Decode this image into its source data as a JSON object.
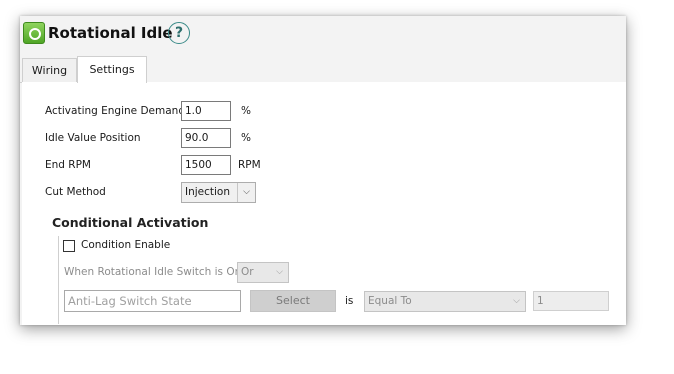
{
  "window": {
    "title": "Rotational Idle",
    "help": "?"
  },
  "tabs": [
    {
      "label": "Wiring",
      "active": false
    },
    {
      "label": "Settings",
      "active": true
    }
  ],
  "settings": {
    "activating_engine_demand": {
      "label": "Activating Engine Demand",
      "value": "1.0",
      "unit": "%"
    },
    "idle_value_position": {
      "label": "Idle Value Position",
      "value": "90.0",
      "unit": "%"
    },
    "end_rpm": {
      "label": "End RPM",
      "value": "1500",
      "unit": "RPM"
    },
    "cut_method": {
      "label": "Cut Method",
      "selected": "Injection"
    }
  },
  "conditional": {
    "heading": "Conditional Activation",
    "enable_label": "Condition Enable",
    "enable_checked": false,
    "switch_label": "When Rotational Idle Switch is On",
    "switch_op": "Or",
    "condition_placeholder": "Anti-Lag Switch State",
    "select_label": "Select",
    "is_label": "is",
    "comparison": "Equal To",
    "compare_value": "1"
  },
  "colors": {
    "icon_green": "#4fa526",
    "help_teal": "#3a8a88",
    "disabled_text": "#8c8c8c"
  }
}
